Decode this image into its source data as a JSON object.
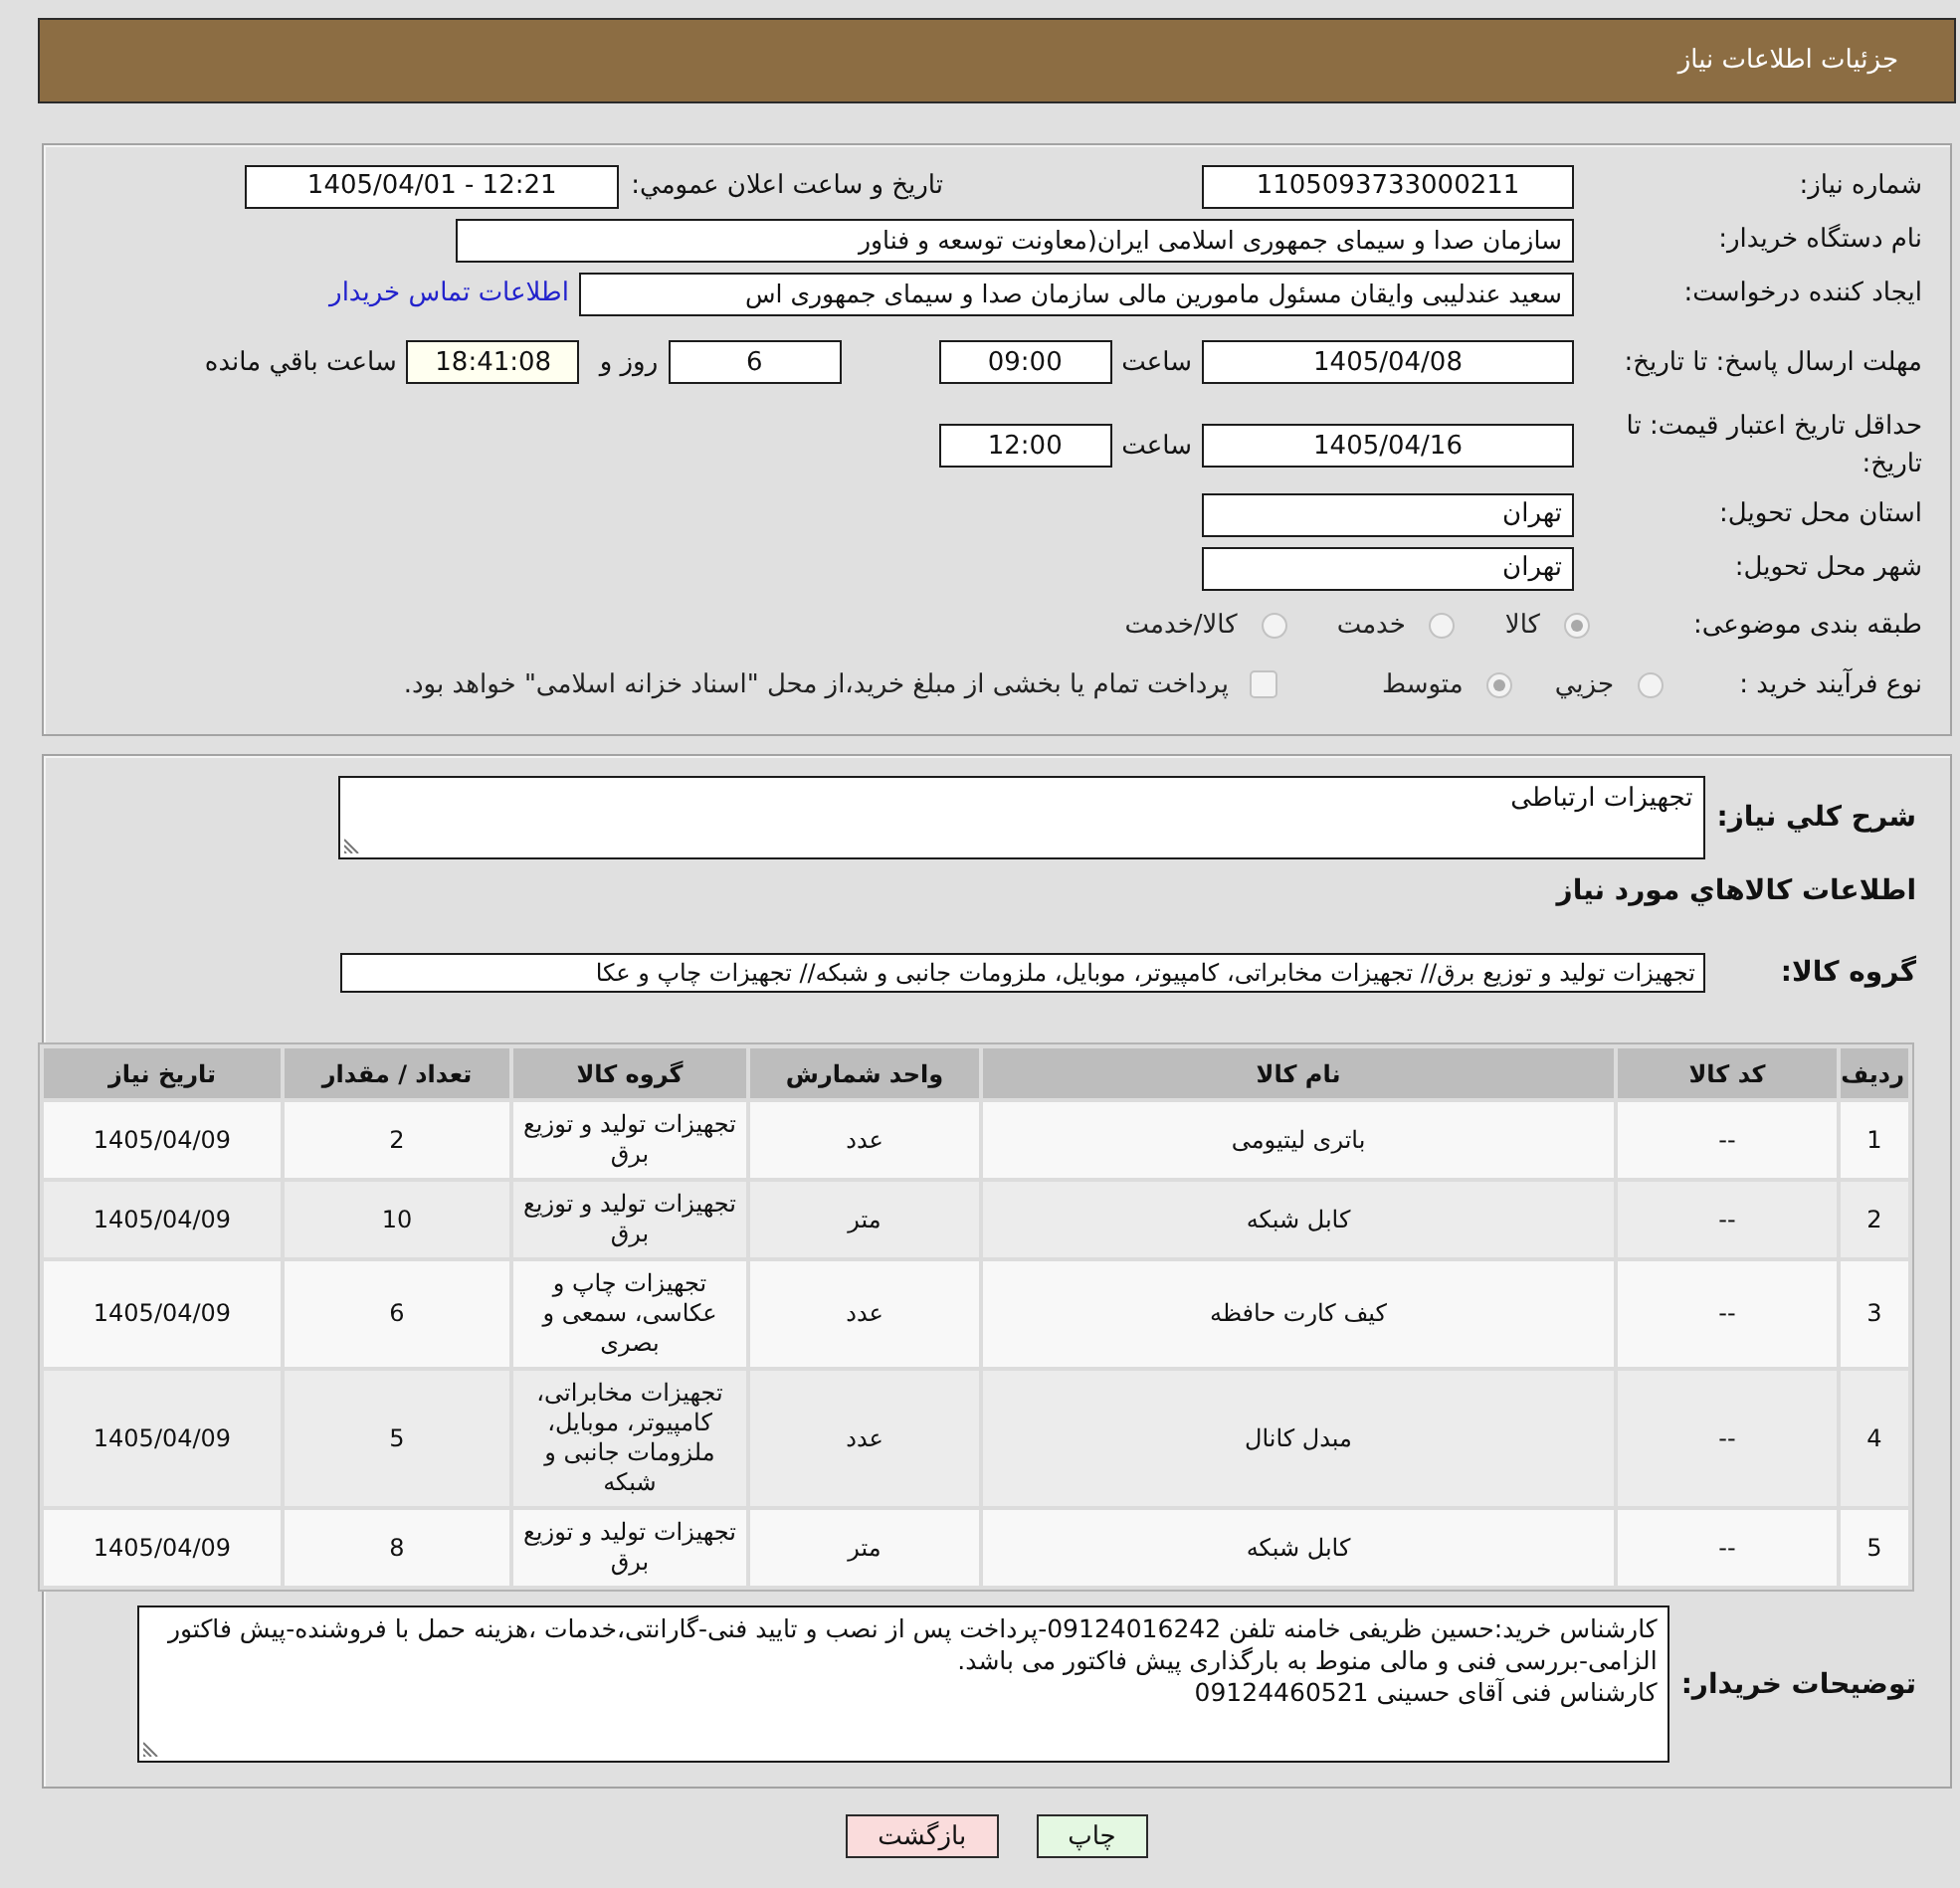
{
  "header": {
    "title": "جزئيات اطلاعات نياز"
  },
  "details": {
    "need_number": {
      "label": "شماره نياز:",
      "value": "1105093733000211"
    },
    "announce": {
      "label": "تاريخ و ساعت اعلان عمومي:",
      "value": "1405/04/01 - 12:21"
    },
    "buyer": {
      "label": "نام دستگاه خريدار:",
      "value": "سازمان صدا و سیمای جمهوری اسلامی ایران(معاونت توسعه و فناور"
    },
    "requester": {
      "label": "ايجاد کننده درخواست:",
      "value": "سعید عندلیبی وایقان مسئول مامورین مالی  سازمان صدا و سیمای جمهوری اس",
      "contact_link": "اطلاعات تماس خريدار"
    },
    "response_deadline": {
      "label": "مهلت ارسال پاسخ: تا تاريخ:",
      "date": "1405/04/08",
      "time_label": "ساعت",
      "time": "09:00",
      "days": "6",
      "days_label": "روز و",
      "remaining": "18:41:08",
      "remaining_label": "ساعت باقي مانده"
    },
    "price_validity": {
      "label": "حداقل تاريخ اعتبار قيمت: تا تاريخ:",
      "date": "1405/04/16",
      "time_label": "ساعت",
      "time": "12:00"
    },
    "province": {
      "label": "استان محل تحويل:",
      "value": "تهران"
    },
    "city": {
      "label": "شهر محل تحويل:",
      "value": "تهران"
    },
    "category": {
      "label": "طبقه بندی موضوعی:",
      "options": [
        {
          "label": "کالا",
          "selected": true
        },
        {
          "label": "خدمت",
          "selected": false
        },
        {
          "label": "کالا/خدمت",
          "selected": false
        }
      ]
    },
    "process": {
      "label": "نوع فرآيند خريد :",
      "options": [
        {
          "label": "جزيي",
          "selected": false
        },
        {
          "label": "متوسط",
          "selected": true
        }
      ],
      "treasury": {
        "label": "پرداخت تمام يا بخشی از مبلغ خريد،از محل \"اسناد خزانه اسلامی\" خواهد بود.",
        "checked": false
      }
    }
  },
  "needs": {
    "description": {
      "label": "شرح کلي نياز:",
      "value": "تجهیزات ارتباطی"
    },
    "section_title": "اطلاعات کالاهاي مورد نياز",
    "goods_group": {
      "label": "گروه کالا:",
      "value": "تجهیزات تولید و توزیع برق// تجهیزات مخابراتی، کامپیوتر، موبایل، ملزومات جانبی و شبکه// تجهیزات چاپ و عکا"
    },
    "table": {
      "columns": [
        "ردیف",
        "کد کالا",
        "نام کالا",
        "واحد شمارش",
        "گروه کالا",
        "تعداد / مقدار",
        "تاریخ نیاز"
      ],
      "rows": [
        [
          "1",
          "--",
          "باتری لیتیومی",
          "عدد",
          "تجهیزات تولید و توزیع برق",
          "2",
          "1405/04/09"
        ],
        [
          "2",
          "--",
          "کابل شبکه",
          "متر",
          "تجهیزات تولید و توزیع برق",
          "10",
          "1405/04/09"
        ],
        [
          "3",
          "--",
          "کیف کارت حافظه",
          "عدد",
          "تجهیزات چاپ و عکاسی، سمعی و بصری",
          "6",
          "1405/04/09"
        ],
        [
          "4",
          "--",
          "مبدل کانال",
          "عدد",
          "تجهیزات مخابراتی، کامپیوتر، موبایل، ملزومات جانبی و شبکه",
          "5",
          "1405/04/09"
        ],
        [
          "5",
          "--",
          "کابل شبکه",
          "متر",
          "تجهیزات تولید و توزیع برق",
          "8",
          "1405/04/09"
        ]
      ]
    },
    "buyer_notes": {
      "label": "توضيحات خريدار:",
      "value": "کارشناس خرید:حسین ظریفی خامنه تلفن 09124016242-پرداخت پس از نصب و تایید فنی-گارانتی،خدمات ،هزینه حمل با فروشنده-پیش فاکتور الزامی-بررسی فنی و مالی منوط به بارگذاری پیش فاکتور می باشد.\nکارشناس فنی آقای حسینی 09124460521"
    }
  },
  "buttons": [
    {
      "label": "چاپ",
      "color": "#e4f8e2"
    },
    {
      "label": "بازگشت",
      "color": "#fadcdc"
    }
  ]
}
